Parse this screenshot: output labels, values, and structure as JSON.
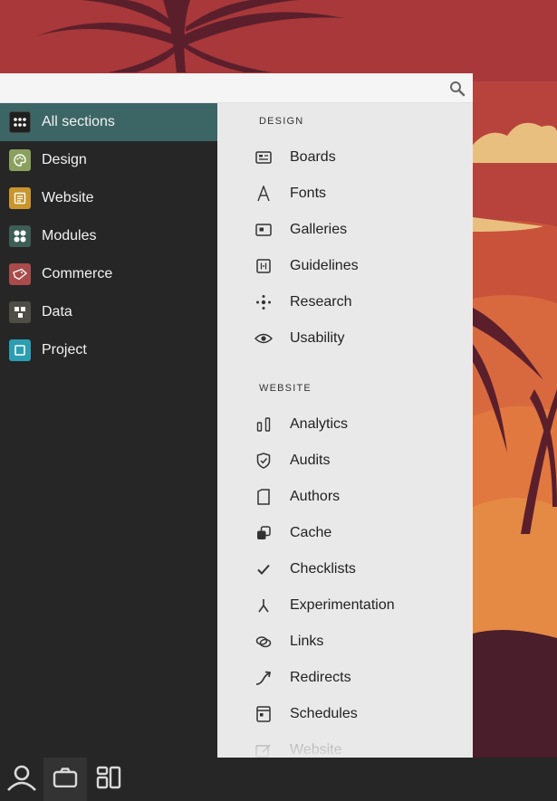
{
  "search": {
    "placeholder": "",
    "value": ""
  },
  "sidebar": {
    "items": [
      {
        "label": "All sections",
        "icon": "grid-icon",
        "color": "#262626",
        "active": true
      },
      {
        "label": "Design",
        "icon": "palette-icon",
        "color": "#8ba05e"
      },
      {
        "label": "Website",
        "icon": "document-icon",
        "color": "#c9952d"
      },
      {
        "label": "Modules",
        "icon": "modules-icon",
        "color": "#3e5d55"
      },
      {
        "label": "Commerce",
        "icon": "tag-icon",
        "color": "#a94b4b"
      },
      {
        "label": "Data",
        "icon": "data-icon",
        "color": "#4e4e44"
      },
      {
        "label": "Project",
        "icon": "square-icon",
        "color": "#2b9eb3"
      }
    ]
  },
  "content": {
    "sections": [
      {
        "title": "DESIGN",
        "items": [
          {
            "label": "Boards",
            "icon": "board-icon"
          },
          {
            "label": "Fonts",
            "icon": "font-icon"
          },
          {
            "label": "Galleries",
            "icon": "gallery-icon"
          },
          {
            "label": "Guidelines",
            "icon": "guidelines-icon"
          },
          {
            "label": "Research",
            "icon": "research-icon"
          },
          {
            "label": "Usability",
            "icon": "eye-icon"
          }
        ]
      },
      {
        "title": "WEBSITE",
        "items": [
          {
            "label": "Analytics",
            "icon": "analytics-icon"
          },
          {
            "label": "Audits",
            "icon": "shield-check-icon"
          },
          {
            "label": "Authors",
            "icon": "author-icon"
          },
          {
            "label": "Cache",
            "icon": "cache-icon"
          },
          {
            "label": "Checklists",
            "icon": "check-icon"
          },
          {
            "label": "Experimentation",
            "icon": "fork-icon"
          },
          {
            "label": "Links",
            "icon": "link-icon"
          },
          {
            "label": "Redirects",
            "icon": "redirect-icon"
          },
          {
            "label": "Schedules",
            "icon": "schedule-icon"
          },
          {
            "label": "Website",
            "icon": "edit-icon"
          }
        ]
      }
    ]
  },
  "bottombar": {
    "buttons": [
      {
        "icon": "user-icon"
      },
      {
        "icon": "briefcase-icon",
        "active": true
      },
      {
        "icon": "layout-icon"
      }
    ]
  },
  "colors": {
    "accent": "#3c6665",
    "sidebar": "#262626",
    "content": "#e9e9e9"
  }
}
